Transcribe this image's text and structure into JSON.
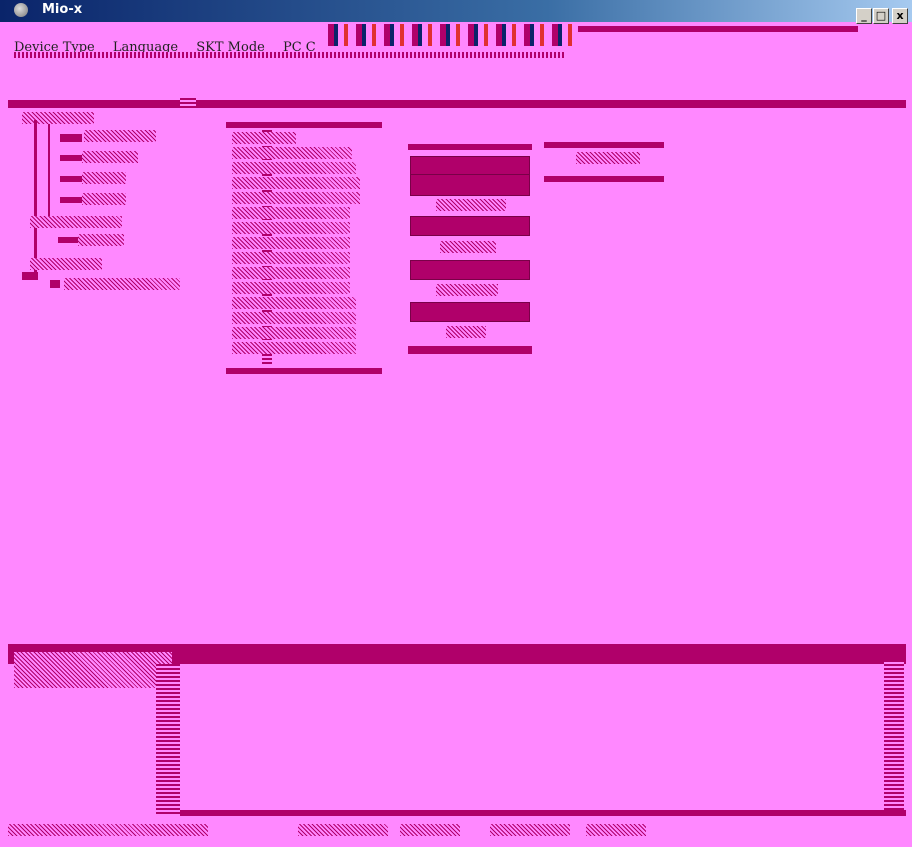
{
  "window": {
    "title": "Mio-x",
    "controls": {
      "minimize": "_",
      "maximize": "□",
      "close": "x"
    }
  },
  "menu": {
    "items": [
      "Device Type",
      "Language",
      "SKT Mode",
      "PC C"
    ]
  },
  "colors": {
    "background": "#ff88ff",
    "accent": "#b0006a",
    "titlebar_start": "#0a246a"
  },
  "tree": {
    "items": [
      "",
      "",
      "",
      "",
      "",
      "",
      "",
      "",
      ""
    ]
  },
  "list": {
    "rows": [
      "",
      "",
      "",
      "",
      "",
      "",
      "",
      "",
      "",
      "",
      "",
      "",
      "",
      "",
      ""
    ]
  },
  "buttons": {
    "items": [
      "",
      "",
      "",
      "",
      ""
    ],
    "captions": [
      "",
      "",
      "",
      "",
      ""
    ]
  },
  "side_field": {
    "value": ""
  },
  "log": {
    "text": ""
  },
  "status": {
    "cells": [
      "",
      "",
      "",
      "",
      ""
    ]
  }
}
